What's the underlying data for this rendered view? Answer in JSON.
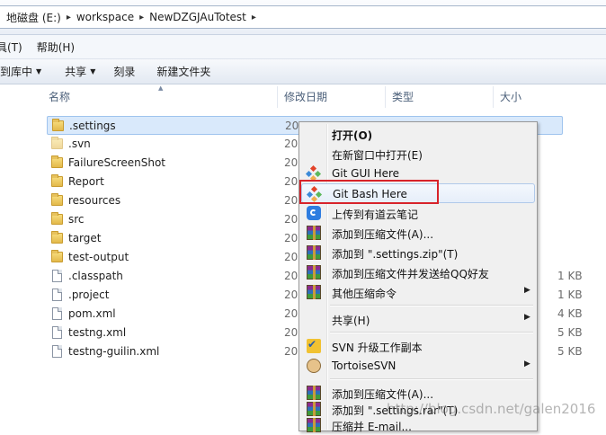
{
  "address": {
    "crumbs": [
      "地磁盘 (E:)",
      "workspace",
      "NewDZGJAuTotest"
    ],
    "separator": "▸"
  },
  "menubar": {
    "items": [
      "具(T)",
      "帮助(H)"
    ]
  },
  "toolbar": {
    "buttons": [
      {
        "label": "到库中",
        "has_dropdown": true
      },
      {
        "label": "共享",
        "has_dropdown": true
      },
      {
        "label": "刻录",
        "has_dropdown": false
      },
      {
        "label": "新建文件夹",
        "has_dropdown": false
      }
    ]
  },
  "columns": {
    "name": "名称",
    "date": "修改日期",
    "type": "类型",
    "size": "大小"
  },
  "files": [
    {
      "name": ".settings",
      "type": "folder",
      "date": "201",
      "size": "",
      "selected": true
    },
    {
      "name": ".svn",
      "type": "folder",
      "date": "201",
      "size": ""
    },
    {
      "name": "FailureScreenShot",
      "type": "folder",
      "date": "201",
      "size": ""
    },
    {
      "name": "Report",
      "type": "folder",
      "date": "201",
      "size": ""
    },
    {
      "name": "resources",
      "type": "folder",
      "date": "201",
      "size": ""
    },
    {
      "name": "src",
      "type": "folder",
      "date": "201",
      "size": ""
    },
    {
      "name": "target",
      "type": "folder",
      "date": "201",
      "size": ""
    },
    {
      "name": "test-output",
      "type": "folder",
      "date": "201",
      "size": ""
    },
    {
      "name": ".classpath",
      "type": "file",
      "date": "201",
      "size": "1 KB"
    },
    {
      "name": ".project",
      "type": "file",
      "date": "201",
      "size": "1 KB"
    },
    {
      "name": "pom.xml",
      "type": "file",
      "date": "201",
      "size": "4 KB"
    },
    {
      "name": "testng.xml",
      "type": "file",
      "date": "201",
      "size": "5 KB"
    },
    {
      "name": "testng-guilin.xml",
      "type": "file",
      "date": "201",
      "size": "5 KB"
    }
  ],
  "context_menu": {
    "items": [
      {
        "label": "打开(O)",
        "bold": true,
        "icon": "",
        "arrow": false
      },
      {
        "label": "在新窗口中打开(E)",
        "icon": "",
        "arrow": false
      },
      {
        "label": "Git GUI Here",
        "icon": "git-gui-icon",
        "arrow": false
      },
      {
        "label": "Git Bash Here",
        "icon": "git-bash-icon",
        "arrow": false,
        "hover": true,
        "highlighted": true
      },
      {
        "label": "上传到有道云笔记",
        "icon": "youdao-note-icon",
        "arrow": false
      },
      {
        "label": "添加到压缩文件(A)...",
        "icon": "winrar-icon",
        "arrow": false
      },
      {
        "label": "添加到 \".settings.zip\"(T)",
        "icon": "winrar-icon",
        "arrow": false
      },
      {
        "label": "添加到压缩文件并发送给QQ好友",
        "icon": "winrar-icon",
        "arrow": false
      },
      {
        "label": "其他压缩命令",
        "icon": "winrar-icon",
        "arrow": true
      },
      {
        "separator": true
      },
      {
        "label": "共享(H)",
        "icon": "",
        "arrow": true
      },
      {
        "separator": true
      },
      {
        "label": "SVN 升级工作副本",
        "icon": "svn-update-icon",
        "arrow": false
      },
      {
        "label": "TortoiseSVN",
        "icon": "tortoisesvn-icon",
        "arrow": true
      },
      {
        "separator": true
      },
      {
        "label": "添加到压缩文件(A)...",
        "icon": "winrar-icon",
        "arrow": false
      },
      {
        "label": "添加到 \".settings.rar\"(T)",
        "icon": "winrar-icon",
        "arrow": false
      },
      {
        "label": "压缩并 E-mail...",
        "icon": "winrar-icon",
        "arrow": false
      }
    ]
  },
  "watermark": "http://blog.csdn.net/galen2016",
  "colors": {
    "highlight": "#d8232a",
    "selection": "#d9e9fb",
    "menu_bg": "#f0f0f0"
  }
}
